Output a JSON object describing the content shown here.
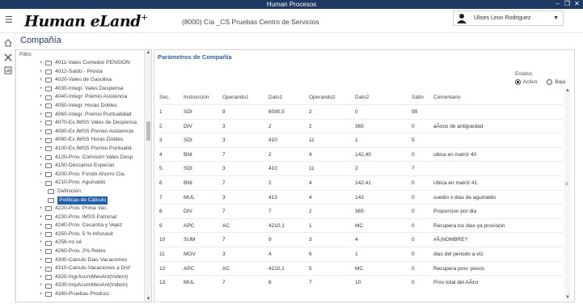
{
  "window": {
    "title": "Human Procesos"
  },
  "header": {
    "logo": "Human eLand",
    "logo_mark": "+",
    "company": "(8000) Cía _CS  Pruebas Centro de Servicios",
    "user": "Ulises Leon Rodriguez"
  },
  "page": {
    "title": "Compañía"
  },
  "tree": {
    "filter_label": "Filtro",
    "items": [
      {
        "label": "4011-Vales Comedor PENSION",
        "level": 0,
        "expander": "+"
      },
      {
        "label": "4012-Saldo - Presta",
        "level": 0,
        "expander": "+"
      },
      {
        "label": "4020-Vales de Gasolina",
        "level": 0,
        "expander": "+"
      },
      {
        "label": "4030-Integr. Vales Despensa",
        "level": 0,
        "expander": "+"
      },
      {
        "label": "4040-Integr. Premio Asistencia",
        "level": 0,
        "expander": "+"
      },
      {
        "label": "4050-Integr. Horas Dobles",
        "level": 0,
        "expander": "+"
      },
      {
        "label": "4060-Integr. Premio Puntualidad",
        "level": 0,
        "expander": "+"
      },
      {
        "label": "4070-Ex.IMSS Vales de Despensa",
        "level": 0,
        "expander": "+"
      },
      {
        "label": "4080-Ex.IMSS Premio Asistencia",
        "level": 0,
        "expander": "+"
      },
      {
        "label": "4090-Ex.IMSS Horas Dobles",
        "level": 0,
        "expander": "+"
      },
      {
        "label": "4100-Ex.IMSS Premio Puntualid.",
        "level": 0,
        "expander": "+"
      },
      {
        "label": "4120-Prov. Comisión Vales Desp",
        "level": 0,
        "expander": "+"
      },
      {
        "label": "4150-Descanso Especial",
        "level": 0,
        "expander": "+"
      },
      {
        "label": "4200-Prov. Fondo Ahorro Cia.",
        "level": 0,
        "expander": "+"
      },
      {
        "label": "4210-Prov. Aguinaldo",
        "level": 0,
        "expander": "-"
      },
      {
        "label": "Definición",
        "level": 1,
        "expander": ""
      },
      {
        "label": "Políticas de Cálculo",
        "level": 1,
        "expander": "",
        "selected": true
      },
      {
        "label": "4220-Prov. Prima Vac.",
        "level": 0,
        "expander": "+"
      },
      {
        "label": "4230-Prov. IMSS Patronal",
        "level": 0,
        "expander": "+"
      },
      {
        "label": "4240-Prov. Cesantía y Vejez",
        "level": 0,
        "expander": "+"
      },
      {
        "label": "4250-Prov. 5 % Infonavit",
        "level": 0,
        "expander": "+"
      },
      {
        "label": "4256-no sé",
        "level": 0,
        "expander": "+"
      },
      {
        "label": "4260-Prov. 2% Retiro",
        "level": 0,
        "expander": "+"
      },
      {
        "label": "4300-Calculo Dias Vacaciones",
        "level": 0,
        "expander": "+"
      },
      {
        "label": "4310-Calculo Vacaciones a Disf",
        "level": 0,
        "expander": "+"
      },
      {
        "label": "4320-IngrAcumMesAnt(Indem)",
        "level": 0,
        "expander": "+"
      },
      {
        "label": "4330-ImpAcumMesAnt(Indem)",
        "level": 0,
        "expander": "+"
      },
      {
        "label": "4340-Pruebas Producc",
        "level": 0,
        "expander": "+"
      }
    ]
  },
  "params": {
    "title": "Parámetros de Compañía",
    "estatus_label": "Estatus",
    "status_options": [
      {
        "label": "Activo",
        "checked": true
      },
      {
        "label": "Baja",
        "checked": false
      }
    ],
    "columns": [
      "Sec.",
      "Instrucción",
      "Operando1",
      "Dato1",
      "Operando2",
      "Dato2",
      "Salto",
      "Comentario"
    ],
    "rows": [
      [
        "1",
        "SDI",
        "9",
        "6090,5",
        "2",
        "0",
        "99",
        ""
      ],
      [
        "2",
        "DIV",
        "3",
        "2",
        "2",
        "365",
        "0",
        "aÃ±os de antiguedad"
      ],
      [
        "3",
        "SDI",
        "3",
        "410",
        "11",
        "1",
        "5",
        ""
      ],
      [
        "4",
        "BNI",
        "7",
        "2",
        "4",
        "142,40",
        "0",
        "ubica en matriz 40"
      ],
      [
        "5",
        "SDI",
        "3",
        "410",
        "11",
        "2",
        "7",
        ""
      ],
      [
        "6",
        "BNI",
        "7",
        "2",
        "4",
        "142,41",
        "0",
        "Ubica en matriz 41"
      ],
      [
        "7",
        "MUL",
        "3",
        "413",
        "4",
        "143",
        "0",
        "sueldo x dias de aguinaldo"
      ],
      [
        "8",
        "DIV",
        "7",
        "7",
        "2",
        "365",
        "0",
        "Proporcion por dia"
      ],
      [
        "9",
        "APC",
        "AC",
        "4210,1",
        "1",
        "MC",
        "0",
        "Recupera los dias ya provision"
      ],
      [
        "10",
        "SUM",
        "7",
        "9",
        "3",
        "4",
        "0",
        "#Â¡NOMBRE?"
      ],
      [
        "11",
        "MOV",
        "3",
        "4",
        "6",
        "1",
        "0",
        "dias del periodo a vt1"
      ],
      [
        "12",
        "APC",
        "AC",
        "4210,1",
        "5",
        "MC",
        "0",
        "Recupera prov. pesos"
      ],
      [
        "13",
        "MUL",
        "7",
        "8",
        "7",
        "10",
        "0",
        "Prov total del AÃ±o"
      ]
    ]
  }
}
